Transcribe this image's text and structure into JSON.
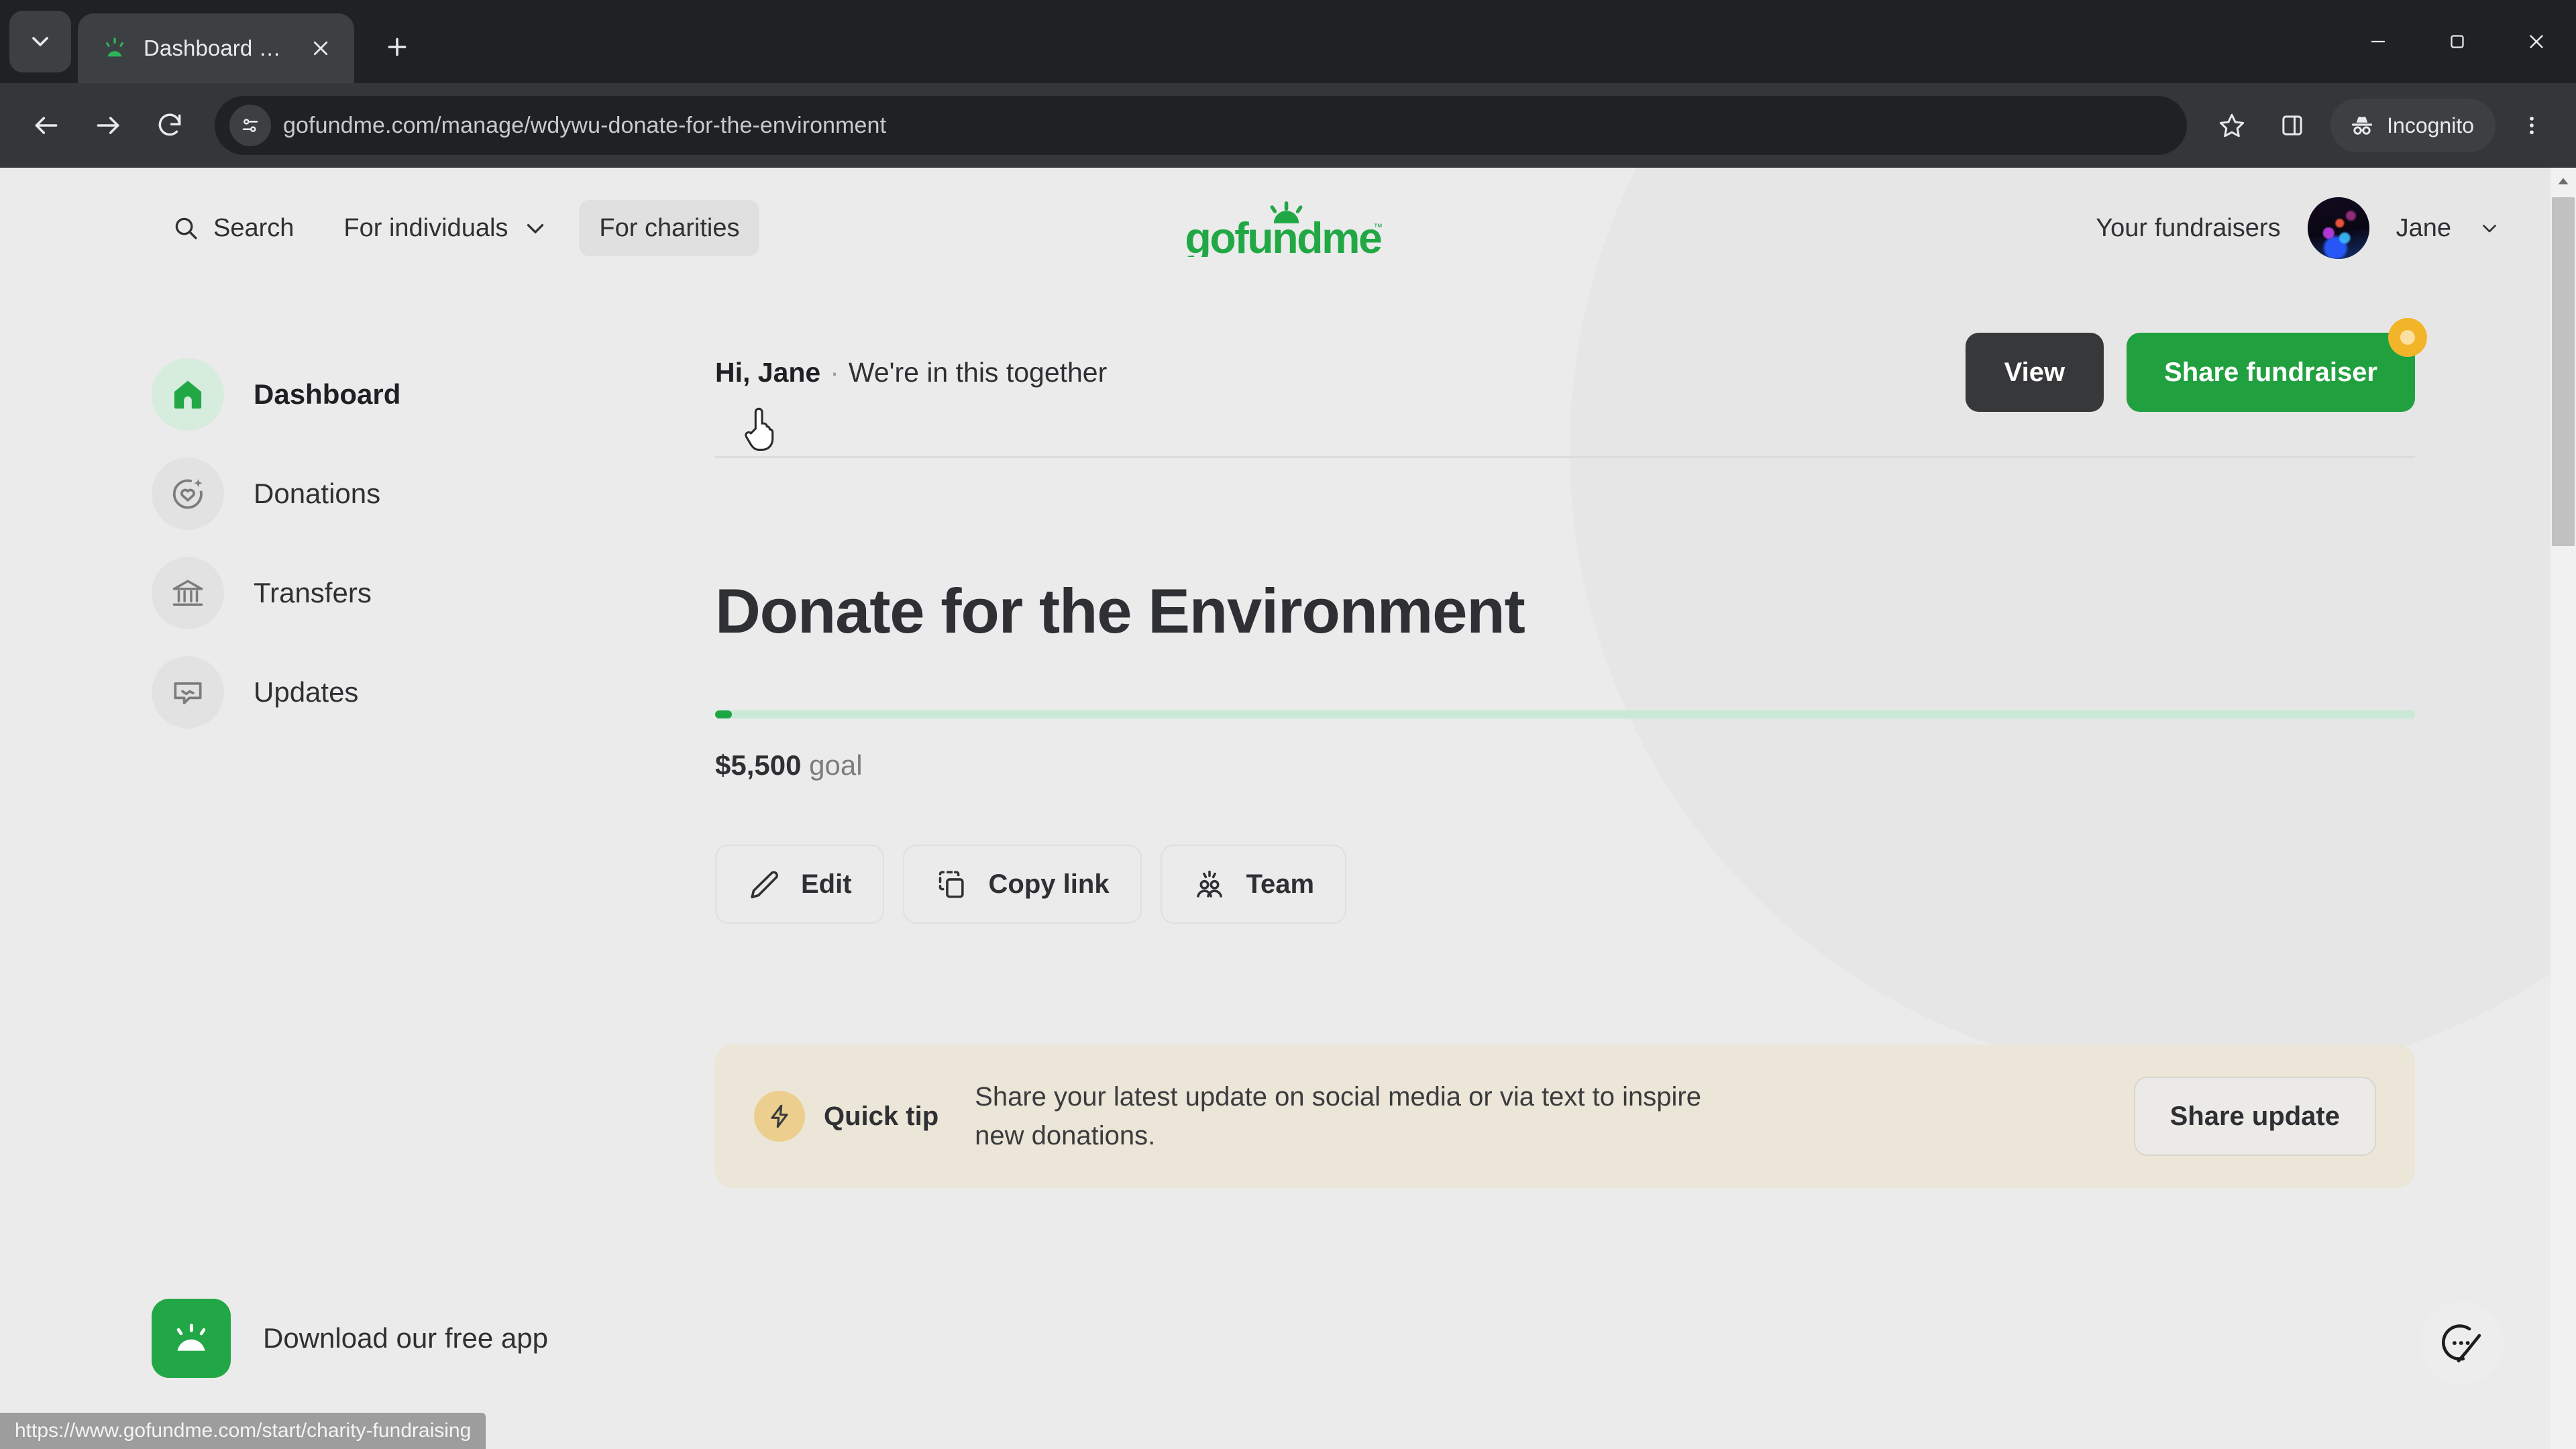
{
  "browser": {
    "tab": {
      "title": "Dashboard - GoFundMe",
      "favicon_icon": "gofundme-favicon"
    },
    "tab_list_icon": "chevron-down-icon",
    "new_tab_icon": "plus-icon",
    "close_tab_icon": "close-icon",
    "window_controls": {
      "minimize_icon": "minimize-icon",
      "maximize_icon": "maximize-icon",
      "close_icon": "close-icon"
    },
    "nav": {
      "back_icon": "back-arrow-icon",
      "forward_icon": "forward-arrow-icon",
      "reload_icon": "reload-icon"
    },
    "omnibox": {
      "url": "gofundme.com/manage/wdywu-donate-for-the-environment",
      "site_info_icon": "site-settings-icon"
    },
    "toolbar_right": {
      "bookmark_icon": "star-icon",
      "side_panel_icon": "side-panel-icon",
      "incognito_label": "Incognito",
      "incognito_icon": "incognito-spy-icon",
      "menu_icon": "three-dot-menu-icon"
    },
    "status_bar": {
      "url": "https://www.gofundme.com/start/charity-fundraising"
    }
  },
  "site_header": {
    "search_label": "Search",
    "search_icon": "search-icon",
    "for_individuals_label": "For individuals",
    "for_individuals_chevron": "chevron-down-icon",
    "for_charities_label": "For charities",
    "logo_text": "gofundme",
    "your_fundraisers_label": "Your fundraisers",
    "user_name": "Jane",
    "user_chevron": "chevron-down-icon",
    "avatar_icon": "avatar"
  },
  "sidebar": {
    "items": [
      {
        "label": "Dashboard",
        "icon": "home-icon",
        "active": true
      },
      {
        "label": "Donations",
        "icon": "heart-circle-sparkle-icon",
        "active": false
      },
      {
        "label": "Transfers",
        "icon": "bank-building-icon",
        "active": false
      },
      {
        "label": "Updates",
        "icon": "speech-bubble-icon",
        "active": false
      }
    ],
    "app_promo": {
      "label": "Download our free app",
      "icon": "gofundme-app-icon"
    }
  },
  "main": {
    "greeting_name": "Hi, Jane",
    "greeting_separator": "·",
    "greeting_tagline": "We're in this together",
    "view_button": "View",
    "share_fundraiser_button": "Share fundraiser",
    "share_badge_icon": "notification-badge",
    "campaign_title": "Donate for the Environment",
    "progress_percent": 1,
    "goal_amount": "$5,500",
    "goal_suffix": "goal",
    "actions": [
      {
        "label": "Edit",
        "icon": "pencil-icon"
      },
      {
        "label": "Copy link",
        "icon": "copy-icon"
      },
      {
        "label": "Team",
        "icon": "team-people-icon"
      }
    ],
    "quick_tip": {
      "label": "Quick tip",
      "icon": "lightning-bolt-icon",
      "body": "Share your latest update on social media or via text to inspire new donations.",
      "button": "Share update"
    }
  },
  "chat_widget": {
    "icon": "chat-bubble-check-icon"
  },
  "colors": {
    "brand_green": "#21a03f",
    "dark_button": "#36383a",
    "page_bg": "#ebebeb",
    "tip_bg": "#ece6d8",
    "badge_amber": "#f2b529"
  }
}
